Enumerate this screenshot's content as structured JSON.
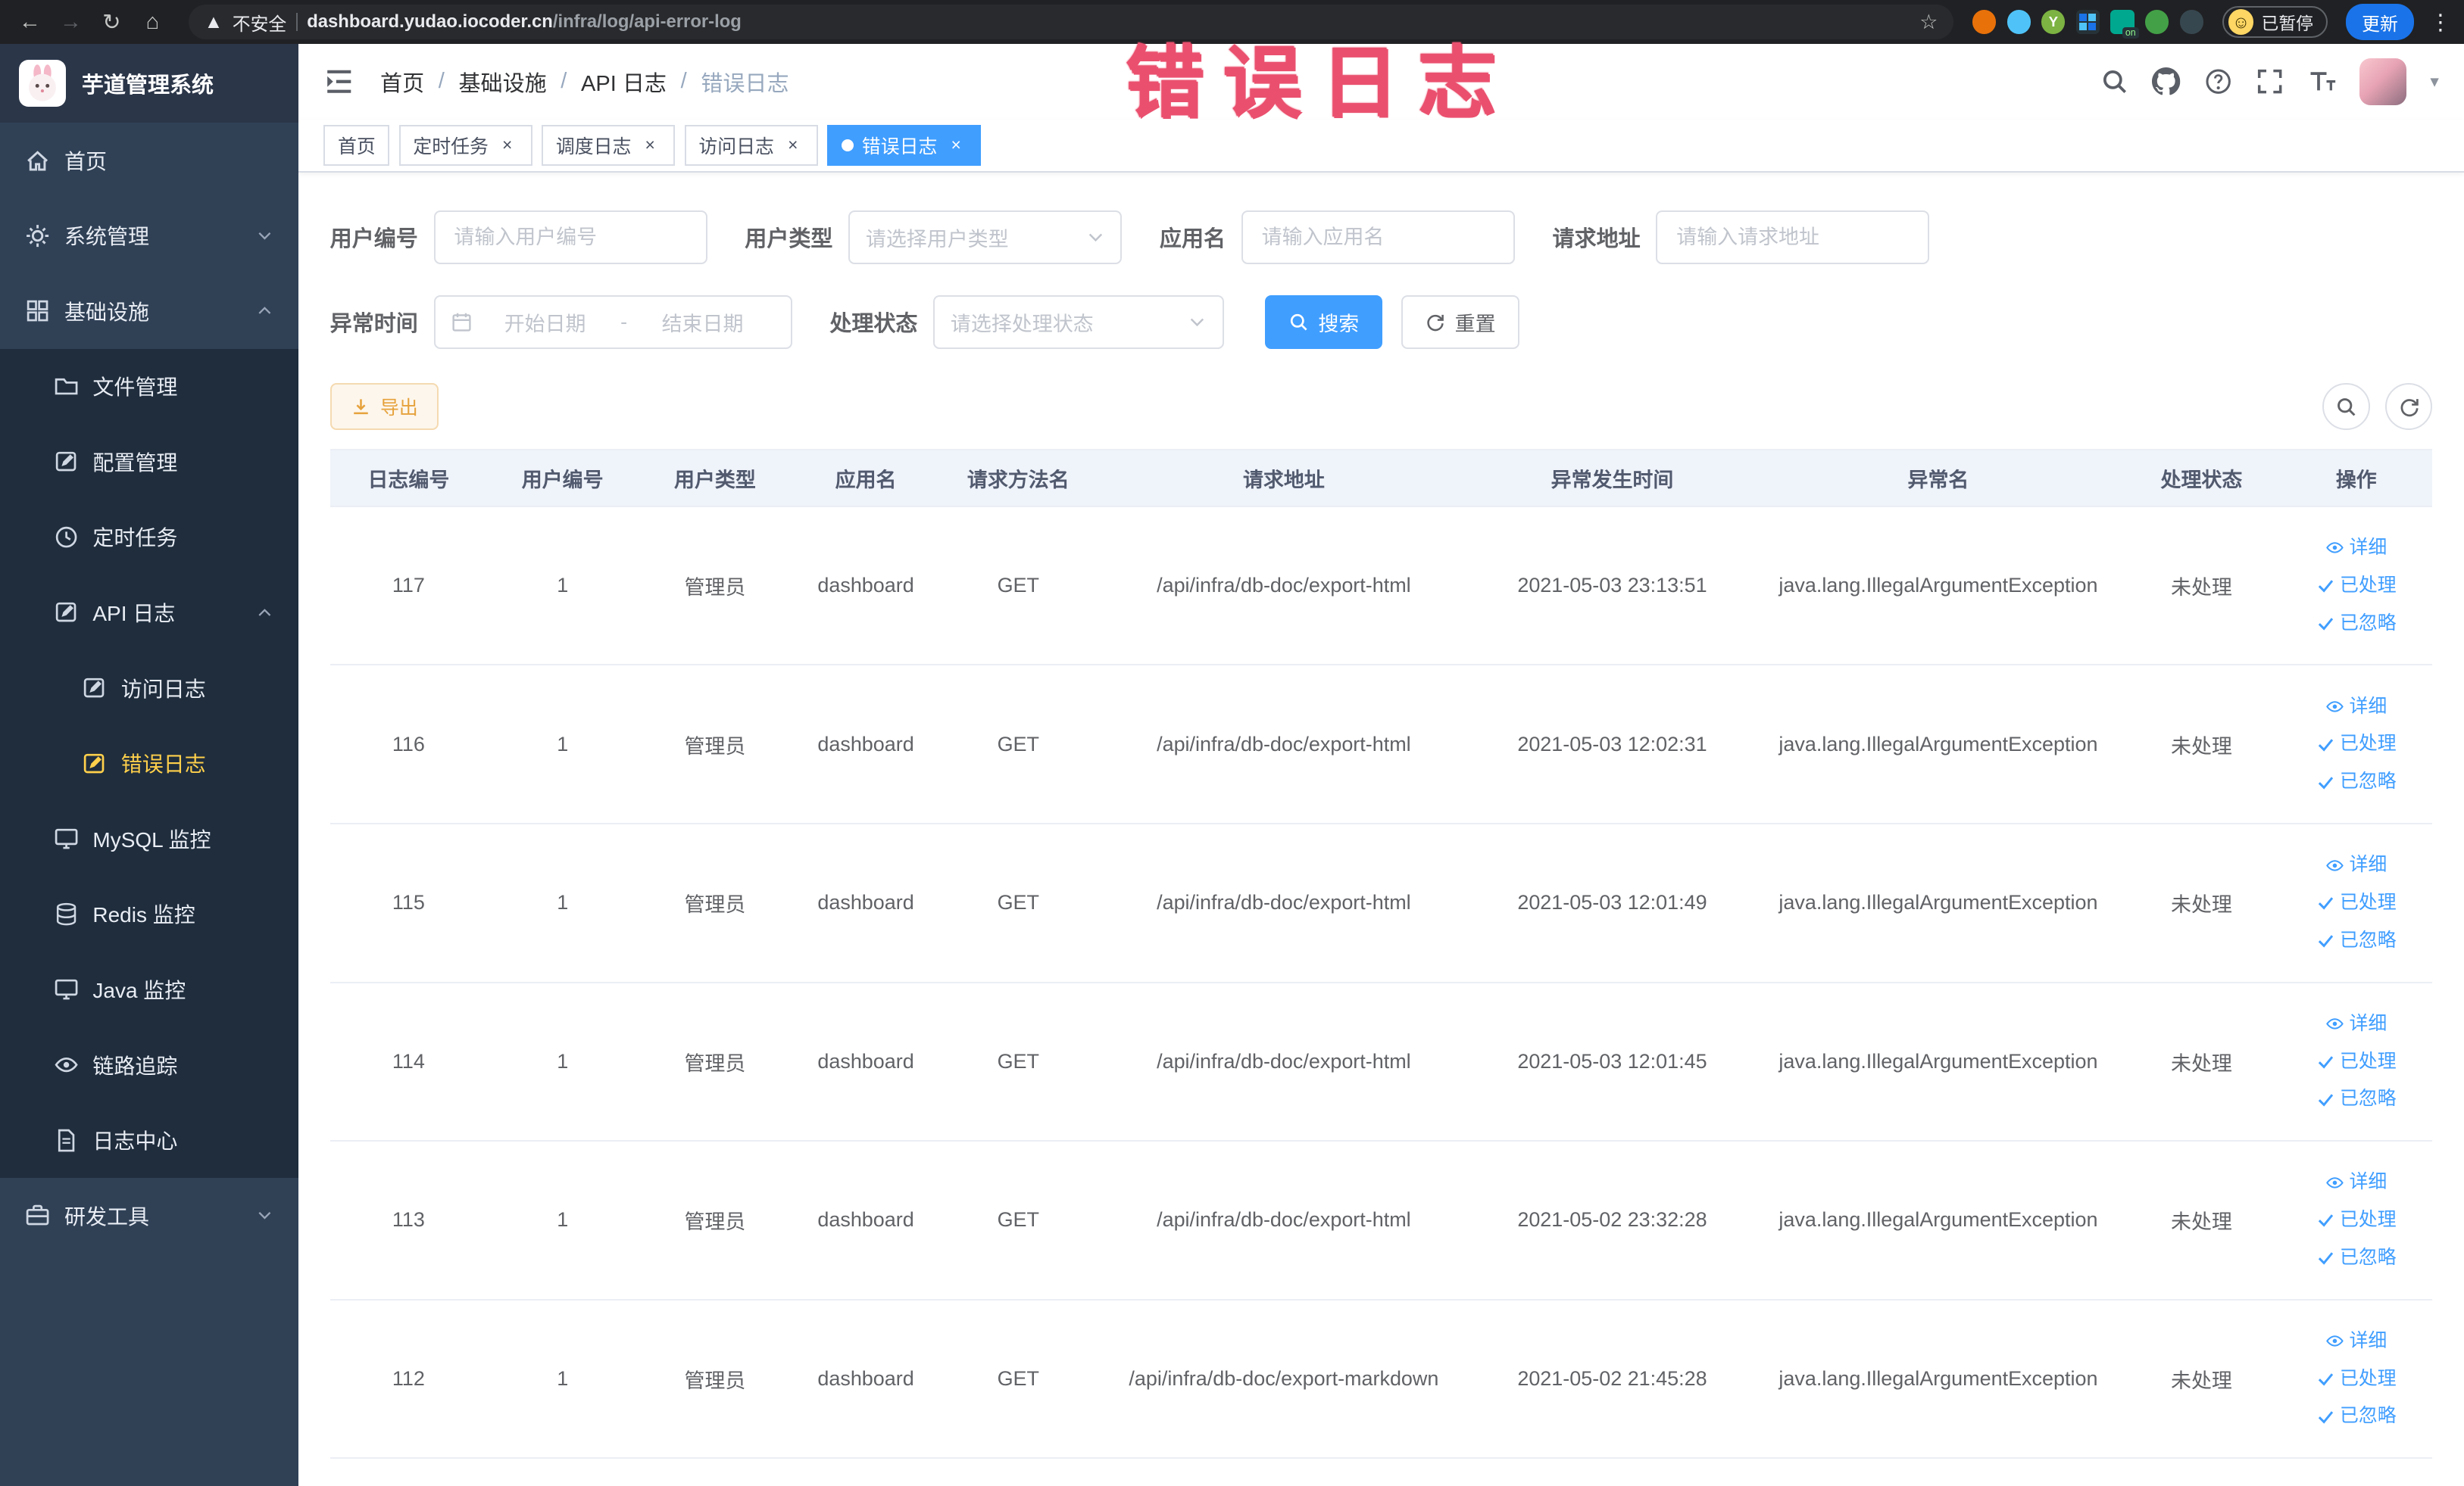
{
  "colors": {
    "accent": "#409EFF",
    "warning": "#e6a23c",
    "sidebar_bg": "#304156",
    "sidebar_active": "#ffd04b",
    "watermark": "#ea506e"
  },
  "browser": {
    "security_label": "不安全",
    "url_domain": "dashboard.yudao.iocoder.cn",
    "url_path": "/infra/log/api-error-log",
    "profile_status": "已暂停",
    "update_button": "更新"
  },
  "watermark": "错误日志",
  "sidebar": {
    "logo_title": "芋道管理系统",
    "items": [
      {
        "label": "首页",
        "icon": "home-icon"
      },
      {
        "label": "系统管理",
        "icon": "gear-icon",
        "expandable": true
      },
      {
        "label": "基础设施",
        "icon": "grid-icon",
        "expandable": true,
        "expanded": true
      },
      {
        "label": "文件管理",
        "icon": "folder-icon"
      },
      {
        "label": "配置管理",
        "icon": "edit-icon"
      },
      {
        "label": "定时任务",
        "icon": "clock-icon"
      },
      {
        "label": "API 日志",
        "icon": "edit-icon",
        "expandable": true,
        "expanded": true
      },
      {
        "label": "访问日志",
        "icon": "edit-icon"
      },
      {
        "label": "错误日志",
        "icon": "edit-icon",
        "active": true
      },
      {
        "label": "MySQL 监控",
        "icon": "monitor-icon"
      },
      {
        "label": "Redis 监控",
        "icon": "database-icon"
      },
      {
        "label": "Java 监控",
        "icon": "monitor-icon"
      },
      {
        "label": "链路追踪",
        "icon": "eye-icon"
      },
      {
        "label": "日志中心",
        "icon": "document-icon"
      },
      {
        "label": "研发工具",
        "icon": "briefcase-icon",
        "expandable": true
      }
    ]
  },
  "header": {
    "breadcrumb": [
      "首页",
      "基础设施",
      "API 日志",
      "错误日志"
    ]
  },
  "tabs": [
    {
      "label": "首页",
      "closable": false,
      "active": false
    },
    {
      "label": "定时任务",
      "closable": true,
      "active": false
    },
    {
      "label": "调度日志",
      "closable": true,
      "active": false
    },
    {
      "label": "访问日志",
      "closable": true,
      "active": false
    },
    {
      "label": "错误日志",
      "closable": true,
      "active": true
    }
  ],
  "filters": {
    "user_id": {
      "label": "用户编号",
      "placeholder": "请输入用户编号"
    },
    "user_type": {
      "label": "用户类型",
      "placeholder": "请选择用户类型"
    },
    "app_name": {
      "label": "应用名",
      "placeholder": "请输入应用名"
    },
    "request_url": {
      "label": "请求地址",
      "placeholder": "请输入请求地址"
    },
    "exception_time": {
      "label": "异常时间",
      "start_placeholder": "开始日期",
      "separator": "-",
      "end_placeholder": "结束日期"
    },
    "process_status": {
      "label": "处理状态",
      "placeholder": "请选择处理状态"
    },
    "search_button": "搜索",
    "reset_button": "重置"
  },
  "toolbar": {
    "export_button": "导出"
  },
  "table": {
    "columns": [
      "日志编号",
      "用户编号",
      "用户类型",
      "应用名",
      "请求方法名",
      "请求地址",
      "异常发生时间",
      "异常名",
      "处理状态",
      "操作"
    ],
    "actions": [
      "详细",
      "已处理",
      "已忽略"
    ],
    "rows": [
      {
        "id": "117",
        "user_id": "1",
        "user_type": "管理员",
        "app": "dashboard",
        "method": "GET",
        "url": "/api/infra/db-doc/export-html",
        "time": "2021-05-03 23:13:51",
        "exception": "java.lang.IllegalArgumentException",
        "status": "未处理"
      },
      {
        "id": "116",
        "user_id": "1",
        "user_type": "管理员",
        "app": "dashboard",
        "method": "GET",
        "url": "/api/infra/db-doc/export-html",
        "time": "2021-05-03 12:02:31",
        "exception": "java.lang.IllegalArgumentException",
        "status": "未处理"
      },
      {
        "id": "115",
        "user_id": "1",
        "user_type": "管理员",
        "app": "dashboard",
        "method": "GET",
        "url": "/api/infra/db-doc/export-html",
        "time": "2021-05-03 12:01:49",
        "exception": "java.lang.IllegalArgumentException",
        "status": "未处理"
      },
      {
        "id": "114",
        "user_id": "1",
        "user_type": "管理员",
        "app": "dashboard",
        "method": "GET",
        "url": "/api/infra/db-doc/export-html",
        "time": "2021-05-03 12:01:45",
        "exception": "java.lang.IllegalArgumentException",
        "status": "未处理"
      },
      {
        "id": "113",
        "user_id": "1",
        "user_type": "管理员",
        "app": "dashboard",
        "method": "GET",
        "url": "/api/infra/db-doc/export-html",
        "time": "2021-05-02 23:32:28",
        "exception": "java.lang.IllegalArgumentException",
        "status": "未处理"
      },
      {
        "id": "112",
        "user_id": "1",
        "user_type": "管理员",
        "app": "dashboard",
        "method": "GET",
        "url": "/api/infra/db-doc/export-markdown",
        "time": "2021-05-02 21:45:28",
        "exception": "java.lang.IllegalArgumentException",
        "status": "未处理"
      }
    ]
  }
}
